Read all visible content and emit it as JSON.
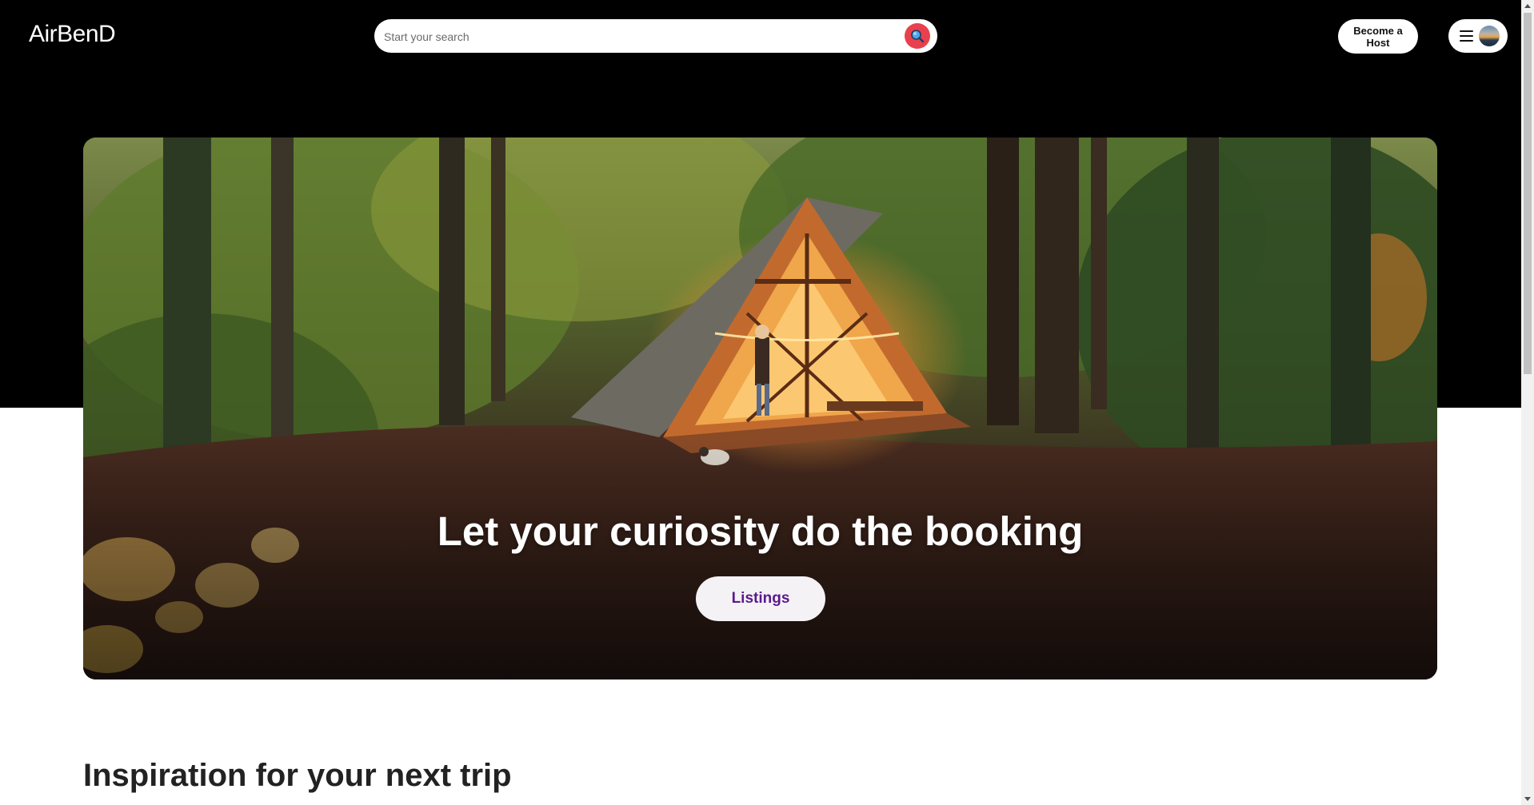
{
  "app": {
    "logo": "AirBenD"
  },
  "search": {
    "placeholder": "Start your search",
    "value": ""
  },
  "header": {
    "become_host_label": "Become a Host",
    "menu_icon": "hamburger-icon",
    "avatar_icon": "user-avatar"
  },
  "hero": {
    "title": "Let your curiosity do the booking",
    "button_label": "Listings",
    "image_subject": "A-frame cabin in forest"
  },
  "main": {
    "section_title": "Inspiration for your next trip"
  },
  "colors": {
    "header_bg": "#000000",
    "search_button": "#e8414d",
    "listings_text": "#5b1a8c",
    "body_text": "#222222"
  }
}
